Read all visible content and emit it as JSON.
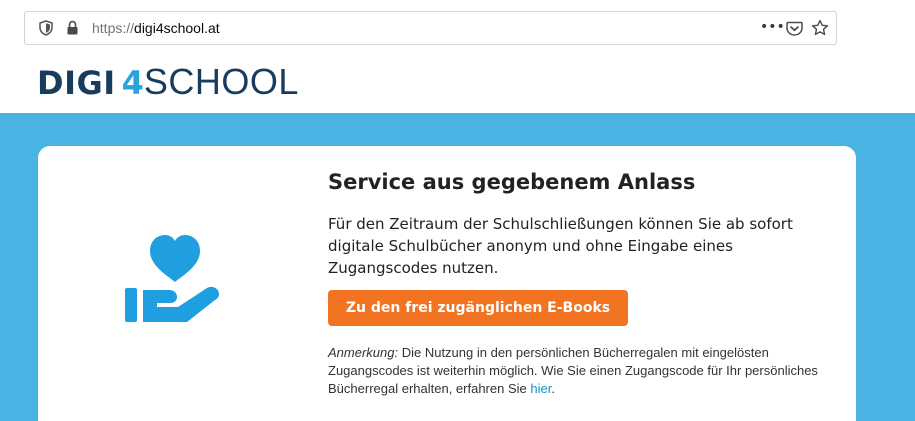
{
  "browser": {
    "url_scheme": "https://",
    "url_host": "digi4school.at",
    "more_label": "•••",
    "icons": [
      "shield-icon",
      "lock-icon",
      "pocket-icon",
      "star-icon"
    ]
  },
  "logo": {
    "part1": "DIGI",
    "part2": "4",
    "part3": "SCHOOL"
  },
  "card": {
    "title": "Service aus gegebenem Anlass",
    "text": "Für den Zeitraum der Schulschließungen können Sie ab sofort digitale Schulbücher anonym und ohne Eingabe eines Zugangscodes nutzen.",
    "button_label": "Zu den frei zugänglichen E-Books",
    "note_label": "Anmerkung:",
    "note_text": " Die Nutzung in den persönlichen Bücherregalen mit eingelösten Zugangscodes ist weiterhin möglich. Wie Sie einen Zugangscode für Ihr persönliches Bücherregal erhalten, erfahren Sie ",
    "note_link": "hier",
    "note_end": ".",
    "icon": "heart-hand-icon"
  },
  "colors": {
    "band": "#49b3e4",
    "logo_dark": "#173c5e",
    "logo_accent": "#29a3dc",
    "button": "#f27321",
    "icon": "#1f9fe0",
    "link": "#1a8fd0"
  }
}
